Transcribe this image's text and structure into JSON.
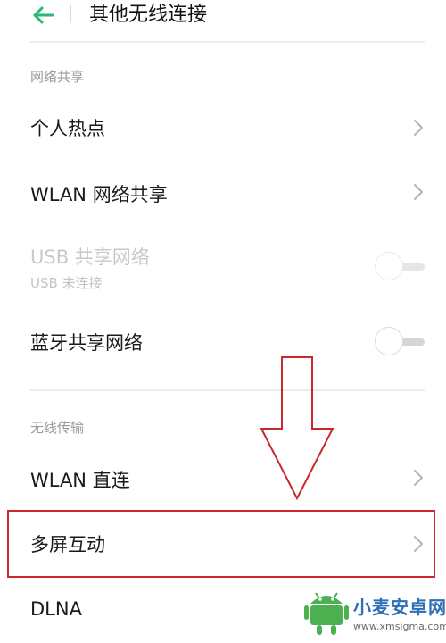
{
  "header": {
    "title": "其他无线连接",
    "back_icon": "arrow-left-icon",
    "accent_color": "#2bb673"
  },
  "sections": {
    "network_sharing": {
      "label": "网络共享",
      "items": {
        "hotspot": {
          "label": "个人热点",
          "control": "chevron"
        },
        "wlan_share": {
          "label": "WLAN 网络共享",
          "control": "chevron"
        },
        "usb_share": {
          "label": "USB 共享网络",
          "sublabel": "USB 未连接",
          "control": "toggle",
          "enabled": false,
          "on": false
        },
        "bt_share": {
          "label": "蓝牙共享网络",
          "control": "toggle",
          "enabled": true,
          "on": false
        }
      }
    },
    "wireless_transfer": {
      "label": "无线传输",
      "items": {
        "wlan_direct": {
          "label": "WLAN 直连",
          "control": "chevron"
        },
        "multi_screen": {
          "label": "多屏互动",
          "control": "chevron",
          "highlighted": true
        },
        "dlna": {
          "label": "DLNA"
        }
      }
    }
  },
  "annotation": {
    "arrow_icon": "down-arrow-outline-icon",
    "highlight_color": "#c8282e"
  },
  "watermark": {
    "name": "小麦安卓网",
    "url": "www.xmsigma.com",
    "logo_icon": "android-robot-logo-icon"
  }
}
